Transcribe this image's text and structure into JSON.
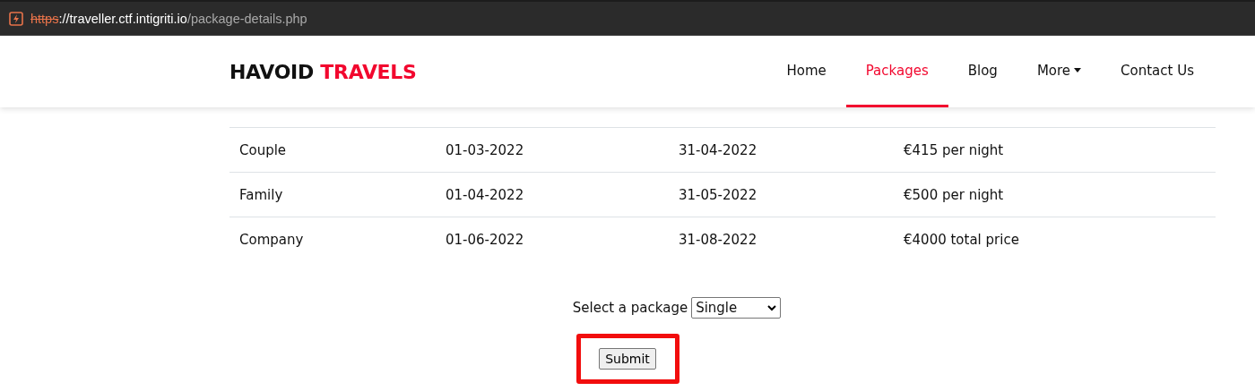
{
  "address_bar": {
    "scheme": "https",
    "host": "://traveller.ctf.intigriti.io",
    "path": "/package-details.php"
  },
  "header": {
    "brand": [
      "HAVOID",
      "TRAVELS"
    ],
    "nav": [
      {
        "label": "Home",
        "selected": false,
        "has_menu": false
      },
      {
        "label": "Packages",
        "selected": true,
        "has_menu": false
      },
      {
        "label": "Blog",
        "selected": false,
        "has_menu": false
      },
      {
        "label": "More",
        "selected": false,
        "has_menu": true
      },
      {
        "label": "Contact Us",
        "selected": false,
        "has_menu": false
      }
    ]
  },
  "table": {
    "rows": [
      [
        "Couple",
        "01-03-2022",
        "31-04-2022",
        "€415 per night"
      ],
      [
        "Family",
        "01-04-2022",
        "31-05-2022",
        "€500 per night"
      ],
      [
        "Company",
        "01-06-2022",
        "31-08-2022",
        "€4000 total price"
      ]
    ]
  },
  "form": {
    "label": "Select a package",
    "value": "Single",
    "submit": "Submit",
    "highlighted": true
  }
}
